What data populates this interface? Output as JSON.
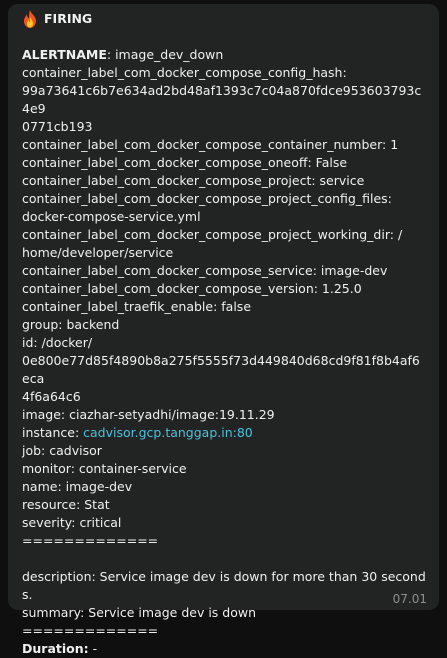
{
  "message": {
    "status": "FIRING",
    "status_icon": "fire-icon",
    "alertname_key": "ALERTNAME",
    "alertname_value": ": image_dev_down",
    "lines": [
      "container_label_com_docker_compose_config_hash:",
      "99a73641c6b7e634ad2bd48af1393c7c04a870fdce953603793c4e9",
      "0771cb193",
      "container_label_com_docker_compose_container_number: 1",
      "container_label_com_docker_compose_oneoff: False",
      "container_label_com_docker_compose_project: service",
      "container_label_com_docker_compose_project_config_files:",
      "docker-compose-service.yml",
      "container_label_com_docker_compose_project_working_dir: /",
      "home/developer/service",
      "container_label_com_docker_compose_service: image-dev",
      "container_label_com_docker_compose_version: 1.25.0",
      "container_label_traefik_enable: false",
      "group: backend",
      "id: /docker/",
      "0e800e77d85f4890b8a275f5555f73d449840d68cd9f81f8b4af6eca",
      "4f6a64c6",
      "image: ciazhar-setyadhi/image:19.11.29"
    ],
    "instance_key": "instance: ",
    "instance_link": "cadvisor.gcp.tanggap.in:80",
    "lines2": [
      "job: cadvisor",
      "monitor: container-service",
      "name: image-dev",
      "resource: Stat",
      "severity: critical",
      "============="
    ],
    "description": "description: Service image dev is down for more than 30 seconds.",
    "summary": "summary: Service image dev is down",
    "separator2": "=============",
    "duration_key": "Duration:",
    "duration_value": " -",
    "time": "07.01"
  },
  "colors": {
    "bubble": "#222323",
    "background": "#0f0f0f",
    "text": "#f0f0f0",
    "link": "#4cc2df",
    "time": "#8d8e8f"
  }
}
